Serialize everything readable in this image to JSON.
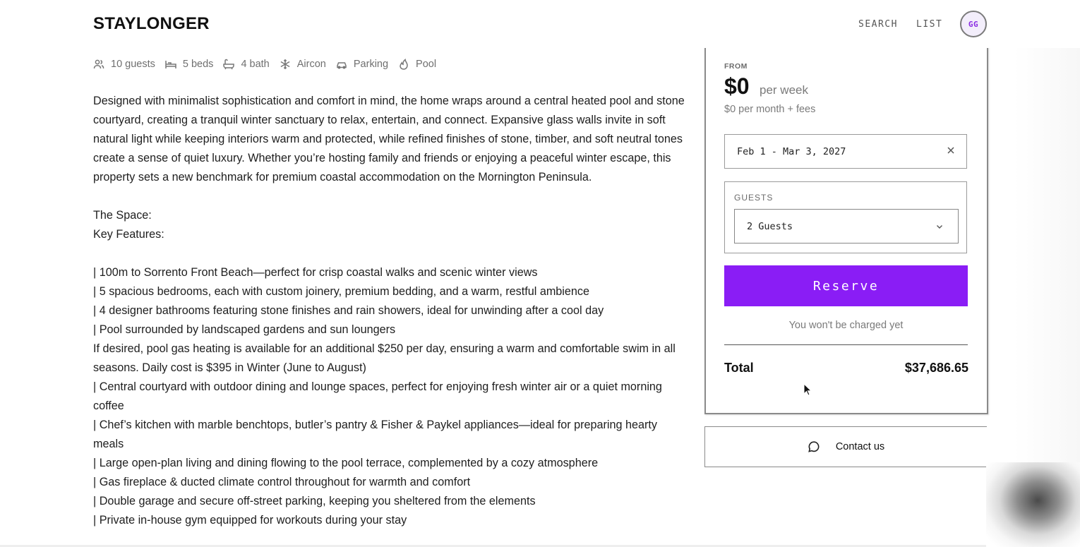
{
  "header": {
    "logo": "STAYLONGER",
    "nav": [
      "SEARCH",
      "LIST"
    ],
    "avatar_initials": "GG",
    "accent_color": "#8a1df5"
  },
  "amenities": [
    {
      "icon": "users-icon",
      "label": "10 guests"
    },
    {
      "icon": "bed-icon",
      "label": "5 beds"
    },
    {
      "icon": "bath-icon",
      "label": "4 bath"
    },
    {
      "icon": "snowflake-icon",
      "label": "Aircon"
    },
    {
      "icon": "car-icon",
      "label": "Parking"
    },
    {
      "icon": "flame-icon",
      "label": "Pool"
    }
  ],
  "description": {
    "intro": "Designed with minimalist sophistication and comfort in mind, the home wraps around a central heated pool and stone courtyard, creating a tranquil winter sanctuary to relax, entertain, and connect. Expansive glass walls invite in soft natural light while keeping interiors warm and protected, while refined finishes of stone, timber, and soft neutral tones create a sense of quiet luxury. Whether you’re hosting family and friends or enjoying a peaceful winter escape, this property sets a new benchmark for premium coastal accommodation on the Mornington Peninsula.",
    "space_heading": "The Space:",
    "features_heading": "Key Features:",
    "features": [
      "| 100m to Sorrento Front Beach—perfect for crisp coastal walks and scenic winter views",
      "| 5 spacious bedrooms, each with custom joinery, premium bedding, and a warm, restful ambience",
      "| 4 designer bathrooms featuring stone finishes and rain showers, ideal for unwinding after a cool day",
      "| Pool surrounded by landscaped gardens and sun loungers",
      "If desired, pool gas heating is available for an additional $250 per day, ensuring a warm and comfortable swim in all seasons. Daily cost is $395 in Winter (June to August)",
      "| Central courtyard with outdoor dining and lounge spaces, perfect for enjoying fresh winter air or a quiet morning coffee",
      "| Chef’s kitchen with marble benchtops, butler’s pantry & Fisher & Paykel appliances—ideal for preparing hearty meals",
      "| Large open-plan living and dining flowing to the pool terrace, complemented by a cozy atmosphere",
      "| Gas fireplace & ducted climate control throughout for warmth and comfort",
      "| Double garage and secure off-street parking, keeping you sheltered from the elements",
      "| Private in-house gym equipped for workouts during your stay"
    ]
  },
  "booking": {
    "from_label": "FROM",
    "price": "$0",
    "price_unit": "per week",
    "price_sub": "$0 per month + fees",
    "dates": "Feb 1 - Mar 3, 2027",
    "guests_label": "GUESTS",
    "guests_value": "2 Guests",
    "reserve_label": "Reserve",
    "charge_note": "You won't be charged yet",
    "total_label": "Total",
    "total_value": "$37,686.65"
  },
  "contact": {
    "label": "Contact us",
    "icon": "chat-bubble-icon"
  }
}
